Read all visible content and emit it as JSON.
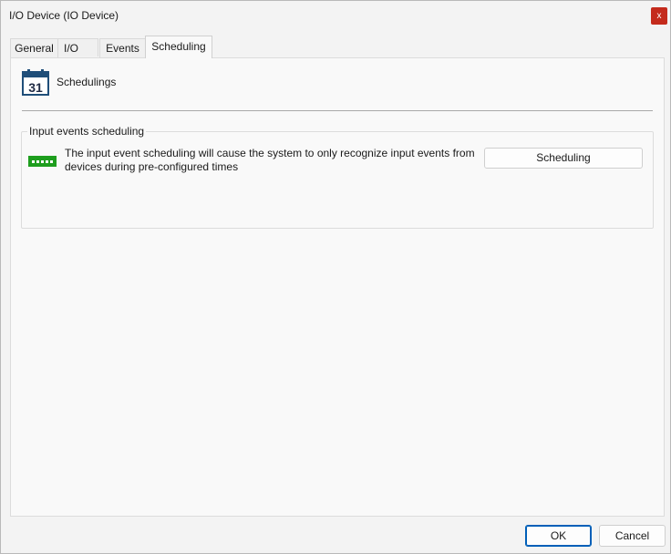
{
  "window": {
    "title": "I/O Device (IO Device)",
    "close_label": "x"
  },
  "tabs": [
    {
      "label": "General"
    },
    {
      "label": "I/O"
    },
    {
      "label": "Events"
    },
    {
      "label": "Scheduling",
      "active": true
    }
  ],
  "header": {
    "icon": "calendar-icon",
    "calendar_day": "31",
    "label": "Schedulings"
  },
  "group": {
    "title": "Input events scheduling",
    "icon": "io-device-icon",
    "description": "The input event scheduling will cause the system to only recognize input events from devices during pre-configured times",
    "button_label": "Scheduling"
  },
  "footer": {
    "ok_label": "OK",
    "cancel_label": "Cancel"
  },
  "colors": {
    "accent": "#005fb8",
    "close": "#c42b1c",
    "calendar": "#1f4e79",
    "device": "#1e9e1e"
  }
}
